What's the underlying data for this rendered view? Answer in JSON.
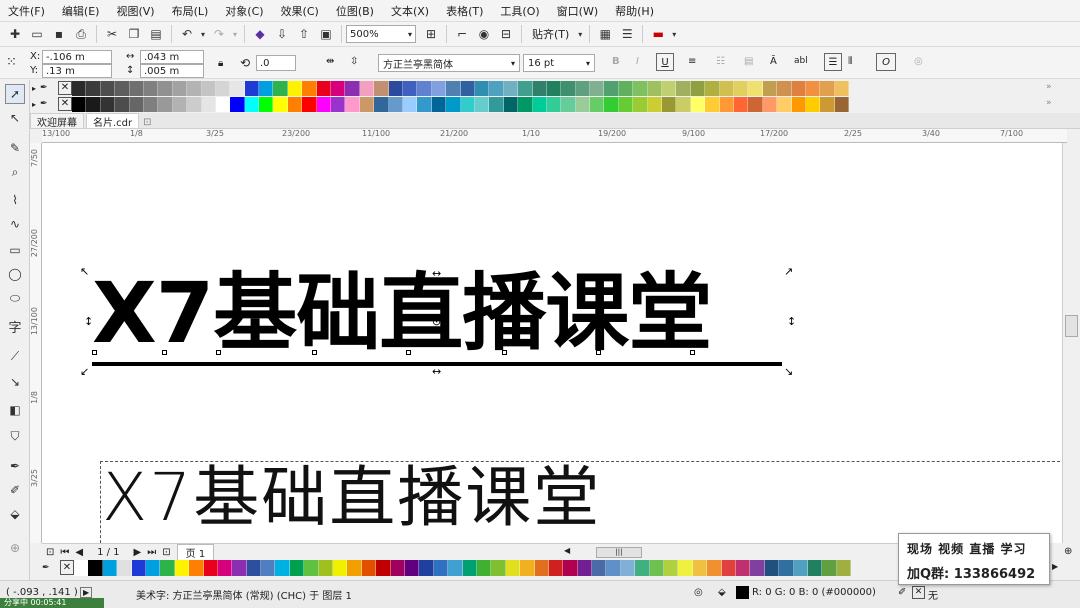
{
  "menu": [
    "文件(F)",
    "编辑(E)",
    "视图(V)",
    "布局(L)",
    "对象(C)",
    "效果(C)",
    "位图(B)",
    "文本(X)",
    "表格(T)",
    "工具(O)",
    "窗口(W)",
    "帮助(H)"
  ],
  "toolbar": {
    "zoom": "500%",
    "snap_label": "贴齐(T)"
  },
  "propbar": {
    "x_label": "X:",
    "x_value": "-.106 m",
    "y_label": "Y:",
    "y_value": ".13 m",
    "w_value": ".043 m",
    "h_value": ".005 m",
    "rotation_value": ".0",
    "font_name": "方正兰亭黑简体",
    "font_size": "16 pt",
    "italic_label": "O"
  },
  "doc_tabs": [
    "欢迎屏幕",
    "名片.cdr"
  ],
  "hruler_ticks": [
    "13/100",
    "1/8",
    "3/25",
    "23/200",
    "11/100",
    "21/200",
    "1/10",
    "19/200",
    "9/100",
    "17/200",
    "2/25",
    "3/40",
    "7/100"
  ],
  "vruler_ticks": [
    "7/50",
    "27/200",
    "13/100",
    "1/8",
    "3/25"
  ],
  "canvas": {
    "big_text": "X7基础直播课堂",
    "thin_text": "X7基础直播课堂"
  },
  "pagenav": {
    "page_count": "1 / 1",
    "page_tab": "页 1"
  },
  "status": {
    "coords": "( -.093 , .141 )",
    "object_info": "美术字: 方正兰亭黑简体 (常规) (CHC) 于 图层 1",
    "fill_info": "R: 0 G: 0 B: 0 (#000000)",
    "outline_info": "无"
  },
  "overlay": {
    "line1": "现场 视频 直播 学习",
    "line2": "加Q群: 133866492"
  },
  "timer": "分享中 00:05:41",
  "palette_top": [
    "#2b2b2b",
    "#3c3c3c",
    "#4d4d4d",
    "#5e5e5e",
    "#6f6f6f",
    "#808080",
    "#919191",
    "#a2a2a2",
    "#b3b3b3",
    "#c4c4c4",
    "#d5d5d5",
    "#e6e6e6",
    "#1f3bd6",
    "#00a0e0",
    "#2db34a",
    "#fff200",
    "#ff7f00",
    "#e8001c",
    "#d6007f",
    "#8b2fb0",
    "#f3a0c0",
    "#c09070",
    "#2a4aa0",
    "#4060c0",
    "#6080d0",
    "#80a0e0",
    "#5080b0",
    "#3060a0",
    "#2f8fb0",
    "#50a0c0",
    "#70b0c0",
    "#40a090",
    "#30806c",
    "#208060",
    "#409070",
    "#60a080",
    "#80b090",
    "#50a070",
    "#60b060",
    "#80c060",
    "#a0c060",
    "#c0d070",
    "#a0b060",
    "#90a040",
    "#b0b040",
    "#d0c050",
    "#e0d060",
    "#f0e070",
    "#c0a050",
    "#d09050",
    "#e08040",
    "#f09040",
    "#e0a050",
    "#f0c060"
  ],
  "palette_bottom": [
    "#000000",
    "#1a1a1a",
    "#333333",
    "#4d4d4d",
    "#666666",
    "#7f7f7f",
    "#999999",
    "#b2b2b2",
    "#cccccc",
    "#e5e5e5",
    "#ffffff",
    "#0000ff",
    "#00ffff",
    "#00ff00",
    "#ffff00",
    "#ff8000",
    "#ff0000",
    "#ff00ff",
    "#9933cc",
    "#ff99cc",
    "#cc9966",
    "#336699",
    "#6699cc",
    "#99ccff",
    "#3399cc",
    "#006699",
    "#0099cc",
    "#33cccc",
    "#66cccc",
    "#339999",
    "#006666",
    "#009966",
    "#00cc99",
    "#33cc99",
    "#66cc99",
    "#99cc99",
    "#66cc66",
    "#33cc33",
    "#66cc33",
    "#99cc33",
    "#cccc33",
    "#999933",
    "#cccc66",
    "#ffff66",
    "#ffcc33",
    "#ff9933",
    "#ff6633",
    "#cc6633",
    "#ff9966",
    "#ffcc66",
    "#ff9900",
    "#ffcc00",
    "#cc9933",
    "#996633"
  ],
  "palette_status": [
    "#ffffff",
    "#000000",
    "#00a0e0",
    "#e0e0e0",
    "#1f3bd6",
    "#00a0e0",
    "#2db34a",
    "#fff200",
    "#ff7f00",
    "#e8001c",
    "#d6007f",
    "#8b2fb0",
    "#2d4fa0",
    "#4f7fc0",
    "#00b0e0",
    "#00a050",
    "#60c040",
    "#a0c020",
    "#f0f000",
    "#f0a000",
    "#e05000",
    "#c00000",
    "#a00060",
    "#600080",
    "#2040a0",
    "#3070c0",
    "#40a0d0",
    "#00a070",
    "#40b030",
    "#80c030",
    "#e0e020",
    "#f0b020",
    "#e07020",
    "#d02020",
    "#b00050",
    "#702090",
    "#4a6aa8",
    "#6090c8",
    "#80b0d8",
    "#40b080",
    "#70c050",
    "#b0d040",
    "#f0f040",
    "#f0c040",
    "#f09030",
    "#e04040",
    "#c03070",
    "#8040a0",
    "#205080",
    "#3070a0",
    "#50a0c0",
    "#208060",
    "#60a040",
    "#a0b040"
  ]
}
